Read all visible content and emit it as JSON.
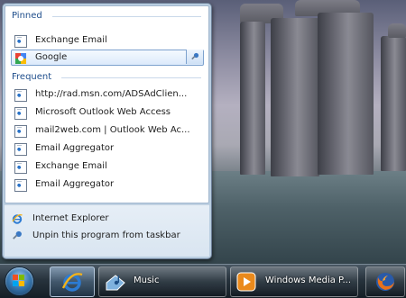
{
  "jumplist": {
    "pinned": {
      "heading": "Pinned",
      "items": [
        {
          "label": "Exchange Email",
          "icon": "page-icon"
        },
        {
          "label": "Google",
          "icon": "google-icon",
          "highlighted": true
        }
      ]
    },
    "frequent": {
      "heading": "Frequent",
      "items": [
        {
          "label": "http://rad.msn.com/ADSAdClien...",
          "icon": "page-icon"
        },
        {
          "label": "Microsoft Outlook Web Access",
          "icon": "page-icon"
        },
        {
          "label": "mail2web.com | Outlook Web Ac...",
          "icon": "page-icon"
        },
        {
          "label": "Email Aggregator",
          "icon": "page-icon"
        },
        {
          "label": "Exchange Email",
          "icon": "page-icon"
        },
        {
          "label": "Email Aggregator",
          "icon": "page-icon"
        }
      ]
    },
    "tasks": [
      {
        "label": "Internet Explorer",
        "icon": "ie-icon"
      },
      {
        "label": "Unpin this program from taskbar",
        "icon": "pin-icon"
      }
    ]
  },
  "taskbar": {
    "buttons": [
      {
        "label": "Music",
        "icon": "music-folder-icon"
      },
      {
        "label": "Windows Media P...",
        "icon": "media-player-icon"
      }
    ]
  },
  "colors": {
    "section_heading": "#1f4e8c",
    "highlight_border": "#7da2ce",
    "taskbar": "#27333d"
  }
}
